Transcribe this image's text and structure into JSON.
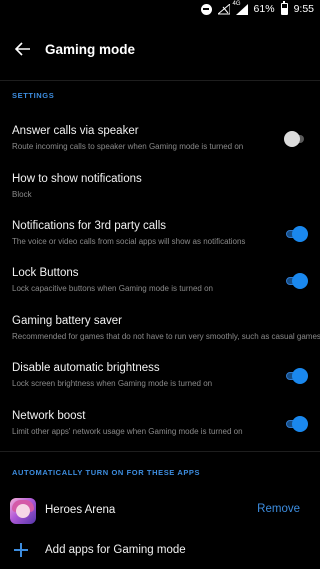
{
  "status_bar": {
    "network": "4G",
    "battery": "61%",
    "battery_level": 0.61,
    "time": "9:55",
    "icons": [
      "do-not-disturb-icon",
      "wifi-off-icon",
      "signal-icon",
      "battery-icon"
    ]
  },
  "toolbar": {
    "title": "Gaming mode",
    "back_icon": "arrow-left-icon"
  },
  "sections": {
    "settings_header": "SETTINGS",
    "auto_header": "AUTOMATICALLY TURN ON FOR THESE APPS"
  },
  "settings": [
    {
      "title": "Answer calls via speaker",
      "subtitle": "Route incoming calls to speaker when Gaming mode is turned on",
      "toggle": "off"
    },
    {
      "title": "How to show notifications",
      "subtitle": "Block",
      "toggle": null
    },
    {
      "title": "Notifications for 3rd party calls",
      "subtitle": "The voice or video calls from social apps will show as notifications",
      "toggle": "on"
    },
    {
      "title": "Lock Buttons",
      "subtitle": "Lock capacitive buttons when Gaming mode is turned on",
      "toggle": "on"
    },
    {
      "title": "Gaming battery saver",
      "subtitle": "Recommended for games that do not have to run very smoothly, such as casual games",
      "toggle": null
    },
    {
      "title": "Disable automatic brightness",
      "subtitle": "Lock screen brightness when Gaming mode is turned on",
      "toggle": "on"
    },
    {
      "title": "Network boost",
      "subtitle": "Limit other apps' network usage when Gaming mode is turned on",
      "toggle": "on"
    }
  ],
  "apps": [
    {
      "name": "Heroes Arena",
      "action": "Remove",
      "icon": "heroes-arena-app-icon"
    }
  ],
  "add_apps_label": "Add apps for Gaming mode",
  "colors": {
    "accent": "#3d8ddf",
    "toggle_on": "#1a88ee",
    "background": "#000000"
  }
}
